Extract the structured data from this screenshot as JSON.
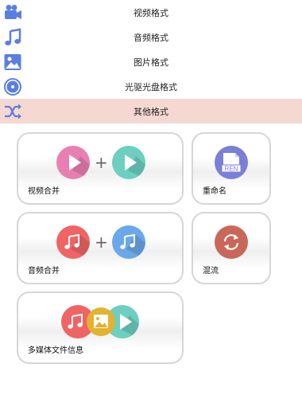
{
  "menu": {
    "items": [
      {
        "label": "视频格式",
        "icon": "video-camera-icon"
      },
      {
        "label": "音频格式",
        "icon": "music-note-icon"
      },
      {
        "label": "图片格式",
        "icon": "picture-icon"
      },
      {
        "label": "光驱光盘格式",
        "icon": "disc-icon"
      },
      {
        "label": "其他格式",
        "icon": "shuffle-icon",
        "active": true
      }
    ]
  },
  "tools": {
    "video_merge": {
      "label": "视频合并",
      "icons": [
        "play-icon",
        "play-icon"
      ]
    },
    "rename": {
      "label": "重命名",
      "icons": [
        "rename-file-icon"
      ],
      "badge": "REN"
    },
    "audio_merge": {
      "label": "音频合并",
      "icons": [
        "music-note-icon",
        "music-note-icon"
      ]
    },
    "mix": {
      "label": "混流",
      "icons": [
        "refresh-icon"
      ]
    },
    "media_info": {
      "label": "多媒体文件信息",
      "icons": [
        "music-note-icon",
        "picture-icon",
        "play-icon"
      ]
    }
  },
  "colors": {
    "menu_icon": "#5b7fe0",
    "active_row": "#f6d8d2",
    "pink": "#e97fb1",
    "teal": "#6ccfc0",
    "red": "#ef6464",
    "blue": "#6aa8ea",
    "purple": "#7b7fd8",
    "brown_red": "#c9685a",
    "yellow": "#e3b22e"
  }
}
